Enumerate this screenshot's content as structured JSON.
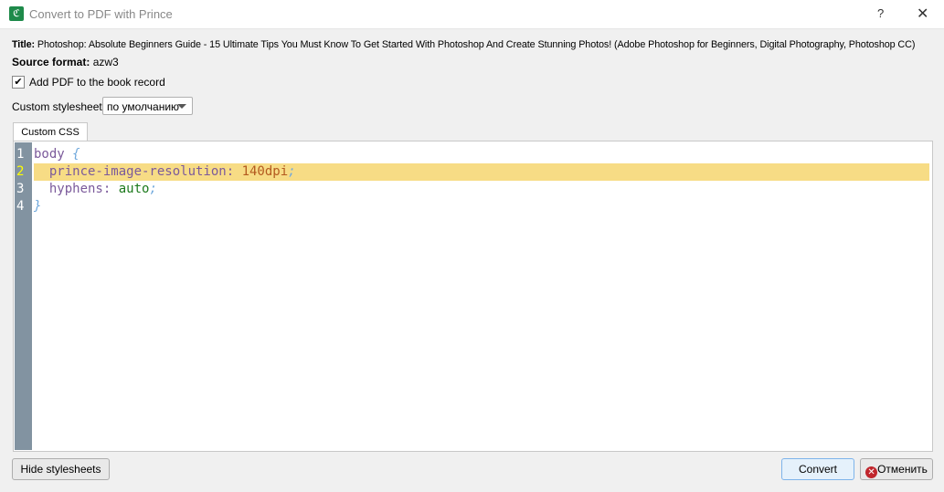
{
  "window": {
    "title": "Convert to PDF with Prince",
    "help": "?",
    "close": "✕"
  },
  "info": {
    "title_label": "Title:",
    "title_value": "Photoshop: Absolute Beginners Guide - 15 Ultimate Tips You Must Know To Get Started With Photoshop And Create Stunning Photos! (Adobe Photoshop for Beginners, Digital Photography, Photoshop CC)",
    "format_label": "Source format:",
    "format_value": "azw3"
  },
  "add_pdf": {
    "label": "Add PDF to the book record",
    "checked": true,
    "mark": "✔"
  },
  "stylesheet": {
    "label": "Custom stylesheet:",
    "value": "по умолчанию"
  },
  "tab": "Custom CSS",
  "editor": {
    "line_numbers": [
      "1",
      "2",
      "3",
      "4"
    ],
    "current_line": 2,
    "lines": [
      [
        {
          "t": "body ",
          "c": "#7b5a9b"
        },
        {
          "t": "{",
          "c": "#6fa8dc"
        }
      ],
      [
        {
          "t": "  prince-image-resolution: ",
          "c": "#7b5a9b"
        },
        {
          "t": "140dpi",
          "c": "#b35a1f"
        },
        {
          "t": ";",
          "c": "#6fa8dc"
        }
      ],
      [
        {
          "t": "  hyphens: ",
          "c": "#7b5a9b"
        },
        {
          "t": "auto",
          "c": "#1d7a1d"
        },
        {
          "t": ";",
          "c": "#6fa8dc"
        }
      ],
      [
        {
          "t": "}",
          "c": "#6fa8dc"
        }
      ]
    ]
  },
  "buttons": {
    "hide": "Hide stylesheets",
    "convert": "Convert",
    "cancel": "Отменить"
  }
}
